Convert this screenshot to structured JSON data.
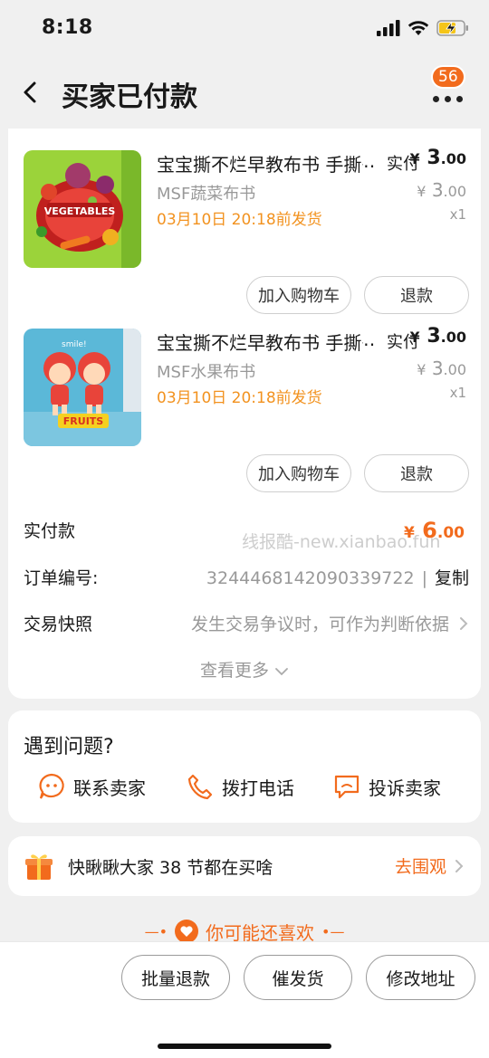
{
  "status_bar": {
    "time": "8:18"
  },
  "nav": {
    "title": "买家已付款",
    "badge_count": "56"
  },
  "items": [
    {
      "title": "宝宝撕不烂早教布书 手撕书",
      "ellipsis": "…",
      "paid_label": "实付",
      "paid_currency": "¥",
      "paid_int": "3",
      "paid_dec": ".00",
      "sku": "MSF蔬菜布书",
      "orig_currency": "¥",
      "orig_int": "3",
      "orig_dec": ".00",
      "ship_note": "03月10日 20:18前发货",
      "qty": "x1",
      "image_label": "VEGETABLES",
      "btn_cart": "加入购物车",
      "btn_refund": "退款"
    },
    {
      "title": "宝宝撕不烂早教布书 手撕书",
      "ellipsis": "…",
      "paid_label": "实付",
      "paid_currency": "¥",
      "paid_int": "3",
      "paid_dec": ".00",
      "sku": "MSF水果布书",
      "orig_currency": "¥",
      "orig_int": "3",
      "orig_dec": ".00",
      "ship_note": "03月10日 20:18前发货",
      "qty": "x1",
      "image_label": "FRUITS",
      "image_small_label": "smile!",
      "btn_cart": "加入购物车",
      "btn_refund": "退款"
    }
  ],
  "summary": {
    "paid_label": "实付款",
    "watermark": "线报酷-new.xianbao.fun",
    "total_currency": "¥",
    "total_int": "6",
    "total_dec": ".00",
    "order_no_label": "订单编号:",
    "order_no": "3244468142090339722",
    "copy_label": "复制",
    "snapshot_label": "交易快照",
    "snapshot_hint": "发生交易争议时，可作为判断依据",
    "see_more": "查看更多"
  },
  "help": {
    "title": "遇到问题?",
    "contact_seller": "联系卖家",
    "call_phone": "拨打电话",
    "complain_seller": "投诉卖家"
  },
  "promo": {
    "text": "快瞅瞅大家 38 节都在买啥",
    "link": "去围观"
  },
  "recommend": {
    "title": "你可能还喜欢"
  },
  "bottom_bar": {
    "batch_refund": "批量退款",
    "urge_ship": "催发货",
    "edit_address": "修改地址"
  },
  "colors": {
    "accent": "#f26b1d",
    "ship_note": "#f2921f",
    "muted": "#999999"
  }
}
